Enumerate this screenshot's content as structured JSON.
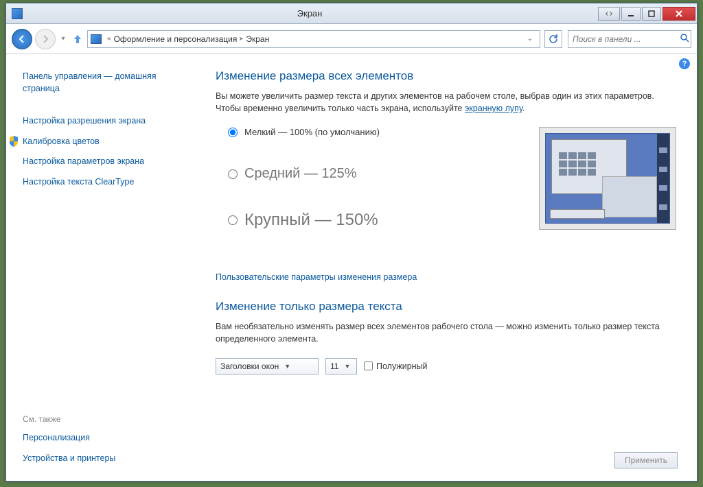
{
  "window": {
    "title": "Экран"
  },
  "breadcrumb": {
    "level1": "Оформление и персонализация",
    "level2": "Экран",
    "prefix": "«"
  },
  "search": {
    "placeholder": "Поиск в панели ..."
  },
  "sidebar": {
    "home": "Панель управления — домашняя страница",
    "items": [
      "Настройка разрешения экрана",
      "Калибровка цветов",
      "Настройка параметров экрана",
      "Настройка текста ClearType"
    ],
    "see_also_title": "См. также",
    "see_also": [
      "Персонализация",
      "Устройства и принтеры"
    ]
  },
  "main": {
    "heading1": "Изменение размера всех элементов",
    "desc1_a": "Вы можете увеличить размер текста и других элементов на рабочем столе, выбрав один из этих параметров. Чтобы временно увеличить только часть экрана, используйте ",
    "desc1_link": "экранную лупу",
    "desc1_b": ".",
    "radios": [
      "Мелкий — 100% (по умолчанию)",
      "Средний — 125%",
      "Крупный — 150%"
    ],
    "custom_link": "Пользовательские параметры изменения размера",
    "heading2": "Изменение только размера текста",
    "desc2": "Вам необязательно изменять размер всех элементов рабочего стола — можно изменить только размер текста определенного элемента.",
    "element_combo": "Заголовки окон",
    "size_combo": "11",
    "bold_label": "Полужирный",
    "apply": "Применить"
  }
}
